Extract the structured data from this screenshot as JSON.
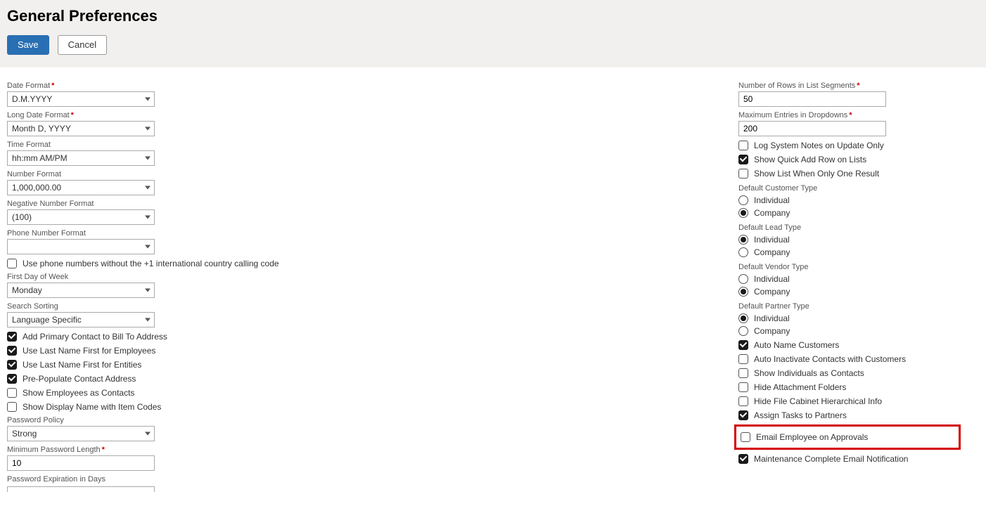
{
  "header": {
    "title": "General Preferences",
    "save": "Save",
    "cancel": "Cancel"
  },
  "left": {
    "dateFormat": {
      "label": "Date Format",
      "value": "D.M.YYYY",
      "required": true
    },
    "longDateFormat": {
      "label": "Long Date Format",
      "value": "Month D, YYYY",
      "required": true
    },
    "timeFormat": {
      "label": "Time Format",
      "value": "hh:mm AM/PM"
    },
    "numberFormat": {
      "label": "Number Format",
      "value": "1,000,000.00"
    },
    "negNumberFormat": {
      "label": "Negative Number Format",
      "value": "(100)"
    },
    "phoneFormat": {
      "label": "Phone Number Format",
      "value": ""
    },
    "phoneNoIntl": {
      "label": "Use phone numbers without the +1 international country calling code",
      "checked": false
    },
    "firstDay": {
      "label": "First Day of Week",
      "value": "Monday"
    },
    "searchSort": {
      "label": "Search Sorting",
      "value": "Language Specific"
    },
    "checks": [
      {
        "label": "Add Primary Contact to Bill To Address",
        "checked": true
      },
      {
        "label": "Use Last Name First for Employees",
        "checked": true
      },
      {
        "label": "Use Last Name First for Entities",
        "checked": true
      },
      {
        "label": "Pre-Populate Contact Address",
        "checked": true
      },
      {
        "label": "Show Employees as Contacts",
        "checked": false
      },
      {
        "label": "Show Display Name with Item Codes",
        "checked": false
      }
    ],
    "passwordPolicy": {
      "label": "Password Policy",
      "value": "Strong"
    },
    "minPwLen": {
      "label": "Minimum Password Length",
      "value": "10",
      "required": true
    },
    "pwExp": {
      "label": "Password Expiration in Days"
    }
  },
  "right": {
    "rowsInSegments": {
      "label": "Number of Rows in List Segments",
      "value": "50",
      "required": true
    },
    "maxDropdown": {
      "label": "Maximum Entries in Dropdowns",
      "value": "200",
      "required": true
    },
    "topChecks": [
      {
        "label": "Log System Notes on Update Only",
        "checked": false
      },
      {
        "label": "Show Quick Add Row on Lists",
        "checked": true
      },
      {
        "label": "Show List When Only One Result",
        "checked": false
      }
    ],
    "radioGroups": [
      {
        "label": "Default Customer Type",
        "opts": [
          "Individual",
          "Company"
        ],
        "selected": "Company"
      },
      {
        "label": "Default Lead Type",
        "opts": [
          "Individual",
          "Company"
        ],
        "selected": "Individual"
      },
      {
        "label": "Default Vendor Type",
        "opts": [
          "Individual",
          "Company"
        ],
        "selected": "Company"
      },
      {
        "label": "Default Partner Type",
        "opts": [
          "Individual",
          "Company"
        ],
        "selected": "Individual"
      }
    ],
    "bottomChecks": [
      {
        "label": "Auto Name Customers",
        "checked": true
      },
      {
        "label": "Auto Inactivate Contacts with Customers",
        "checked": false
      },
      {
        "label": "Show Individuals as Contacts",
        "checked": false
      },
      {
        "label": "Hide Attachment Folders",
        "checked": false
      },
      {
        "label": "Hide File Cabinet Hierarchical Info",
        "checked": false
      },
      {
        "label": "Assign Tasks to Partners",
        "checked": true
      },
      {
        "label": "Email Employee on Approvals",
        "checked": false,
        "highlight": true
      },
      {
        "label": "Maintenance Complete Email Notification",
        "checked": true
      }
    ]
  }
}
